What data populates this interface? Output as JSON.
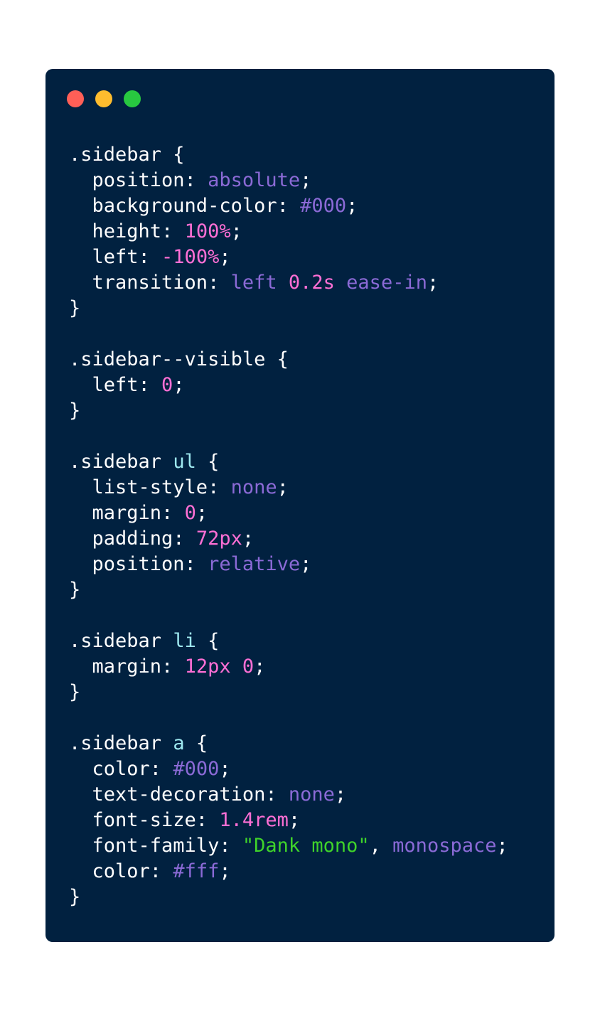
{
  "window": {
    "background": "#012140",
    "controls": [
      {
        "name": "close",
        "color": "#ff5f57"
      },
      {
        "name": "minimize",
        "color": "#febc2e"
      },
      {
        "name": "zoom",
        "color": "#28c840"
      }
    ]
  },
  "syntax_colors": {
    "plain": "#ffffff",
    "keyword": "#8b6ad6",
    "number": "#ff6fd5",
    "tag": "#9ee9f0",
    "string": "#3fd32a"
  },
  "code_lines": [
    [
      {
        "t": ".sidebar {",
        "c": "plain"
      }
    ],
    [
      {
        "t": "  position: ",
        "c": "plain"
      },
      {
        "t": "absolute",
        "c": "keyword"
      },
      {
        "t": ";",
        "c": "plain"
      }
    ],
    [
      {
        "t": "  background-color: ",
        "c": "plain"
      },
      {
        "t": "#000",
        "c": "keyword"
      },
      {
        "t": ";",
        "c": "plain"
      }
    ],
    [
      {
        "t": "  height: ",
        "c": "plain"
      },
      {
        "t": "100%",
        "c": "number"
      },
      {
        "t": ";",
        "c": "plain"
      }
    ],
    [
      {
        "t": "  left: ",
        "c": "plain"
      },
      {
        "t": "-100%",
        "c": "number"
      },
      {
        "t": ";",
        "c": "plain"
      }
    ],
    [
      {
        "t": "  transition: ",
        "c": "plain"
      },
      {
        "t": "left",
        "c": "keyword"
      },
      {
        "t": " ",
        "c": "plain"
      },
      {
        "t": "0.2s",
        "c": "number"
      },
      {
        "t": " ",
        "c": "plain"
      },
      {
        "t": "ease-in",
        "c": "keyword"
      },
      {
        "t": ";",
        "c": "plain"
      }
    ],
    [
      {
        "t": "}",
        "c": "plain"
      }
    ],
    [
      {
        "t": "",
        "c": "plain"
      }
    ],
    [
      {
        "t": ".sidebar--visible {",
        "c": "plain"
      }
    ],
    [
      {
        "t": "  left: ",
        "c": "plain"
      },
      {
        "t": "0",
        "c": "number"
      },
      {
        "t": ";",
        "c": "plain"
      }
    ],
    [
      {
        "t": "}",
        "c": "plain"
      }
    ],
    [
      {
        "t": "",
        "c": "plain"
      }
    ],
    [
      {
        "t": ".sidebar ",
        "c": "plain"
      },
      {
        "t": "ul",
        "c": "tag"
      },
      {
        "t": " {",
        "c": "plain"
      }
    ],
    [
      {
        "t": "  list-style: ",
        "c": "plain"
      },
      {
        "t": "none",
        "c": "keyword"
      },
      {
        "t": ";",
        "c": "plain"
      }
    ],
    [
      {
        "t": "  margin: ",
        "c": "plain"
      },
      {
        "t": "0",
        "c": "number"
      },
      {
        "t": ";",
        "c": "plain"
      }
    ],
    [
      {
        "t": "  padding: ",
        "c": "plain"
      },
      {
        "t": "72px",
        "c": "number"
      },
      {
        "t": ";",
        "c": "plain"
      }
    ],
    [
      {
        "t": "  position: ",
        "c": "plain"
      },
      {
        "t": "relative",
        "c": "keyword"
      },
      {
        "t": ";",
        "c": "plain"
      }
    ],
    [
      {
        "t": "}",
        "c": "plain"
      }
    ],
    [
      {
        "t": "",
        "c": "plain"
      }
    ],
    [
      {
        "t": ".sidebar ",
        "c": "plain"
      },
      {
        "t": "li",
        "c": "tag"
      },
      {
        "t": " {",
        "c": "plain"
      }
    ],
    [
      {
        "t": "  margin: ",
        "c": "plain"
      },
      {
        "t": "12px",
        "c": "number"
      },
      {
        "t": " ",
        "c": "plain"
      },
      {
        "t": "0",
        "c": "number"
      },
      {
        "t": ";",
        "c": "plain"
      }
    ],
    [
      {
        "t": "}",
        "c": "plain"
      }
    ],
    [
      {
        "t": "",
        "c": "plain"
      }
    ],
    [
      {
        "t": ".sidebar ",
        "c": "plain"
      },
      {
        "t": "a",
        "c": "tag"
      },
      {
        "t": " {",
        "c": "plain"
      }
    ],
    [
      {
        "t": "  color: ",
        "c": "plain"
      },
      {
        "t": "#000",
        "c": "keyword"
      },
      {
        "t": ";",
        "c": "plain"
      }
    ],
    [
      {
        "t": "  text-decoration: ",
        "c": "plain"
      },
      {
        "t": "none",
        "c": "keyword"
      },
      {
        "t": ";",
        "c": "plain"
      }
    ],
    [
      {
        "t": "  font-size: ",
        "c": "plain"
      },
      {
        "t": "1.4rem",
        "c": "number"
      },
      {
        "t": ";",
        "c": "plain"
      }
    ],
    [
      {
        "t": "  font-family: ",
        "c": "plain"
      },
      {
        "t": "\"Dank mono\"",
        "c": "string"
      },
      {
        "t": ", ",
        "c": "plain"
      },
      {
        "t": "monospace",
        "c": "keyword"
      },
      {
        "t": ";",
        "c": "plain"
      }
    ],
    [
      {
        "t": "  color: ",
        "c": "plain"
      },
      {
        "t": "#fff",
        "c": "keyword"
      },
      {
        "t": ";",
        "c": "plain"
      }
    ],
    [
      {
        "t": "}",
        "c": "plain"
      }
    ]
  ]
}
